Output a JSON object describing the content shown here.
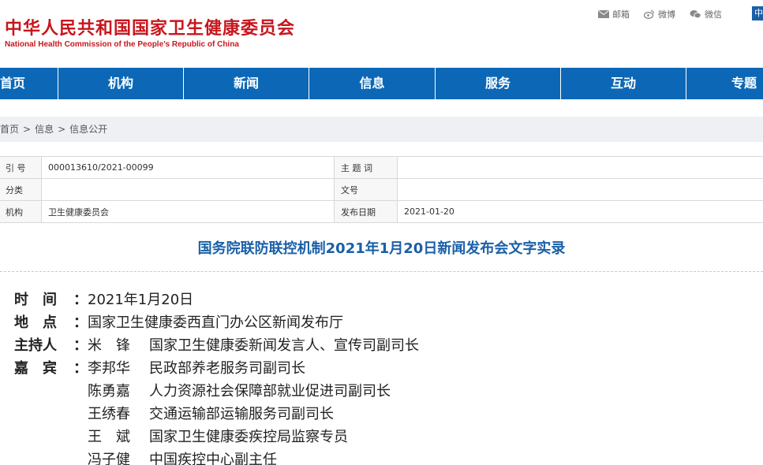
{
  "header": {
    "logo_cn": "中华人民共和国国家卫生健康委员会",
    "logo_en": "National Health Commission of the People’s Republic of China",
    "links": [
      {
        "label": "邮箱",
        "icon": "mail-icon"
      },
      {
        "label": "微博",
        "icon": "weibo-icon"
      },
      {
        "label": "微信",
        "icon": "wechat-icon"
      }
    ],
    "lang": "中"
  },
  "nav": [
    "首页",
    "机构",
    "新闻",
    "信息",
    "服务",
    "互动",
    "专题"
  ],
  "breadcrumb": [
    "首页",
    "信息",
    "信息公开"
  ],
  "meta": {
    "index_label": "引 号",
    "index_value": "000013610/2021-00099",
    "theme_label": "主 题 词",
    "theme_value": "",
    "category_label": "分类",
    "category_value": "",
    "docno_label": "文号",
    "docno_value": "",
    "org_label": "机构",
    "org_value": "卫生健康委员会",
    "date_label": "发布日期",
    "date_value": "2021-01-20"
  },
  "title": "国务院联防联控机制2021年1月20日新闻发布会文字实录",
  "content": {
    "time_label": "时　间",
    "time_value": "2021年1月20日",
    "place_label": "地　点",
    "place_value": "国家卫生健康委西直门办公区新闻发布厅",
    "host_label": "主持人",
    "host_name": "米　锋",
    "host_role": "国家卫生健康委新闻发言人、宣传司副司长",
    "guests_label": "嘉　宾",
    "guests": [
      {
        "name": "李邦华",
        "role": "民政部养老服务司副司长"
      },
      {
        "name": "陈勇嘉",
        "role": "人力资源社会保障部就业促进司副司长"
      },
      {
        "name": "王绣春",
        "role": "交通运输部运输服务司副司长"
      },
      {
        "name": "王　斌",
        "role": "国家卫生健康委疾控局监察专员"
      },
      {
        "name": "冯子健",
        "role": "中国疾控中心副主任"
      }
    ]
  },
  "colors": {
    "brand_red": "#c8161d",
    "nav_blue": "#0c68b6",
    "title_blue": "#1a5fa8"
  }
}
